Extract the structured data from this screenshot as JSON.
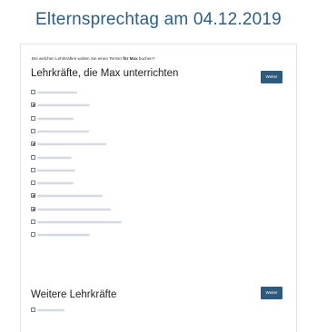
{
  "page": {
    "title": "Elternsprechtag am 04.12.2019",
    "question_prefix": "Bei welchen Lehrkräften wollen Sie einen Termin ",
    "question_bold": "für Max",
    "question_suffix": " buchen?"
  },
  "sections": [
    {
      "title": "Lehrkräfte, die Max unterrichten",
      "button_label": "Weiter",
      "teachers": [
        {
          "checked": false
        },
        {
          "checked": true
        },
        {
          "checked": false
        },
        {
          "checked": false
        },
        {
          "checked": true
        },
        {
          "checked": false
        },
        {
          "checked": false
        },
        {
          "checked": false
        },
        {
          "checked": true
        },
        {
          "checked": true
        },
        {
          "checked": false
        },
        {
          "checked": false
        }
      ]
    },
    {
      "title": "Weitere Lehrkräfte",
      "button_label": "Weiter",
      "teachers": [
        {
          "checked": false
        }
      ]
    }
  ],
  "colors": {
    "title": "#2b5f86",
    "button": "#2e5a7d"
  }
}
